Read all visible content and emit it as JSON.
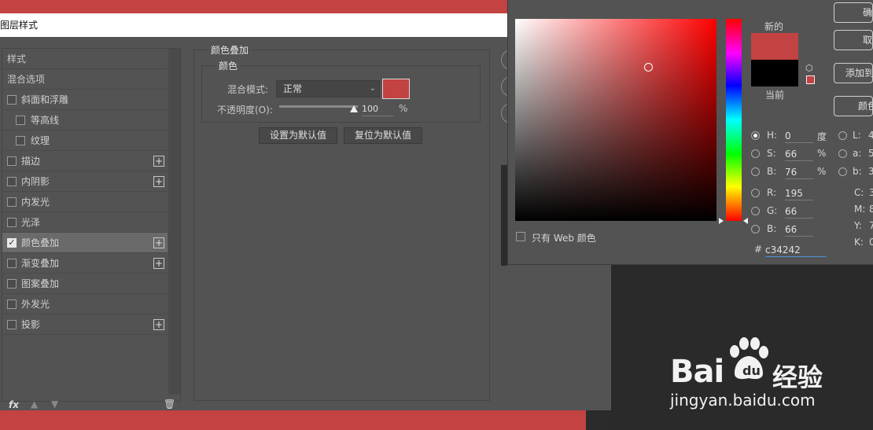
{
  "dialog": {
    "title": "图层样式",
    "sidebar": {
      "header_styles": "样式",
      "header_blend": "混合选项",
      "items": [
        {
          "label": "斜面和浮雕",
          "checked": false,
          "has_plus": false,
          "indent": false
        },
        {
          "label": "等高线",
          "checked": false,
          "has_plus": false,
          "indent": true
        },
        {
          "label": "纹理",
          "checked": false,
          "has_plus": false,
          "indent": true
        },
        {
          "label": "描边",
          "checked": false,
          "has_plus": true,
          "indent": false
        },
        {
          "label": "内阴影",
          "checked": false,
          "has_plus": true,
          "indent": false
        },
        {
          "label": "内发光",
          "checked": false,
          "has_plus": false,
          "indent": false
        },
        {
          "label": "光泽",
          "checked": false,
          "has_plus": false,
          "indent": false
        },
        {
          "label": "颜色叠加",
          "checked": true,
          "has_plus": true,
          "indent": false,
          "active": true
        },
        {
          "label": "渐变叠加",
          "checked": false,
          "has_plus": true,
          "indent": false
        },
        {
          "label": "图案叠加",
          "checked": false,
          "has_plus": false,
          "indent": false
        },
        {
          "label": "外发光",
          "checked": false,
          "has_plus": false,
          "indent": false
        },
        {
          "label": "投影",
          "checked": false,
          "has_plus": true,
          "indent": false
        }
      ],
      "footer_fx": "fx",
      "icons": {
        "up": "arrow-up-icon",
        "down": "arrow-down-icon",
        "trash": "trash-icon",
        "plus": "plus-icon"
      }
    },
    "panel": {
      "section_title": "颜色叠加",
      "group_title": "颜色",
      "blend_label": "混合模式:",
      "blend_value": "正常",
      "opacity_label": "不透明度(O):",
      "opacity_value": "100",
      "opacity_fraction": 1.0,
      "opacity_unit": "%",
      "overlay_color": "#c34242",
      "btn_set_default": "设置为默认值",
      "btn_reset_default": "复位为默认值"
    }
  },
  "picker": {
    "label_new": "新的",
    "label_current": "当前",
    "new_color": "#c34242",
    "current_color": "#000000",
    "web_only_label": "只有 Web 颜色",
    "fields": {
      "H": {
        "label": "H:",
        "value": "0",
        "unit": "度"
      },
      "S": {
        "label": "S:",
        "value": "66",
        "unit": "%"
      },
      "B": {
        "label": "B:",
        "value": "76",
        "unit": "%"
      },
      "R": {
        "label": "R:",
        "value": "195"
      },
      "G": {
        "label": "G:",
        "value": "66"
      },
      "B2": {
        "label": "B:",
        "value": "66"
      },
      "L": {
        "label": "L:",
        "value": "4"
      },
      "a": {
        "label": "a:",
        "value": "5"
      },
      "b": {
        "label": "b:",
        "value": "3"
      },
      "C": {
        "label": "C:",
        "value": "3"
      },
      "M": {
        "label": "M:",
        "value": "8"
      },
      "Y": {
        "label": "Y:",
        "value": "7"
      },
      "K": {
        "label": "K:",
        "value": "0"
      }
    },
    "hex_label": "#",
    "hex_value": "c34242",
    "buttons": {
      "ok": "确",
      "cancel": "取",
      "add_swatch": "添加到",
      "libraries": "颜色"
    }
  },
  "watermark": {
    "brand": "Bai",
    "brand_cn": "经验",
    "url": "jingyan.baidu.com"
  }
}
